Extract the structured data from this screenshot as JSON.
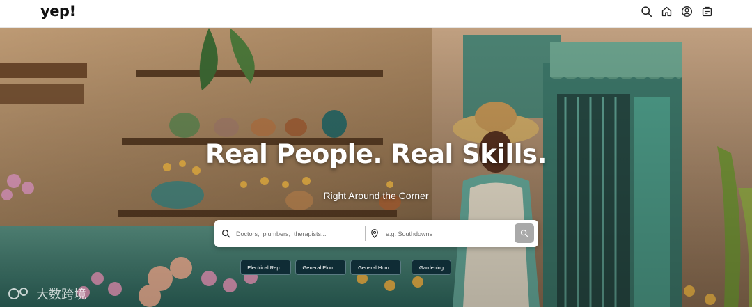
{
  "header": {
    "logo": "yep!",
    "icons": [
      "search-icon",
      "home-icon",
      "user-icon",
      "briefcase-icon"
    ]
  },
  "hero": {
    "headline": "Real People. Real Skills.",
    "subheadline": "Right Around the Corner"
  },
  "search": {
    "service_placeholder": "Doctors,  plumbers,  therapists...",
    "location_placeholder": "e.g. Southdowns"
  },
  "chips": [
    "Electrical Rep...",
    "General Plum...",
    "General Hom...",
    "Gardening"
  ],
  "watermark": "大数跨境",
  "colors": {
    "chip_bg": "#0f2c35",
    "search_button": "#a9a9a9"
  }
}
